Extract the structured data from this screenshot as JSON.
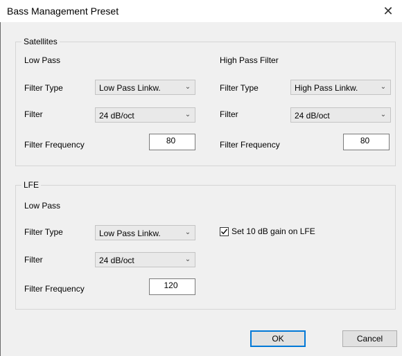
{
  "window": {
    "title": "Bass Management Preset",
    "close_glyph": "✕"
  },
  "satellites": {
    "legend": "Satellites",
    "low_pass": {
      "heading": "Low Pass",
      "filter_type_label": "Filter Type",
      "filter_type_value": "Low Pass Linkw.",
      "filter_label": "Filter",
      "filter_value": "24 dB/oct",
      "frequency_label": "Filter Frequency",
      "frequency_value": "80"
    },
    "high_pass": {
      "heading": "High Pass Filter",
      "filter_type_label": "Filter Type",
      "filter_type_value": "High Pass Linkw.",
      "filter_label": "Filter",
      "filter_value": "24 dB/oct",
      "frequency_label": "Filter Frequency",
      "frequency_value": "80"
    }
  },
  "lfe": {
    "legend": "LFE",
    "low_pass": {
      "heading": "Low Pass",
      "filter_type_label": "Filter Type",
      "filter_type_value": "Low Pass Linkw.",
      "filter_label": "Filter",
      "filter_value": "24 dB/oct",
      "frequency_label": "Filter Frequency",
      "frequency_value": "120"
    },
    "gain_checkbox": {
      "label": "Set 10 dB gain on LFE",
      "checked": true
    }
  },
  "buttons": {
    "ok": "OK",
    "cancel": "Cancel"
  },
  "colors": {
    "dialog_bg": "#f0f0f0",
    "default_button_border": "#0078d7"
  }
}
